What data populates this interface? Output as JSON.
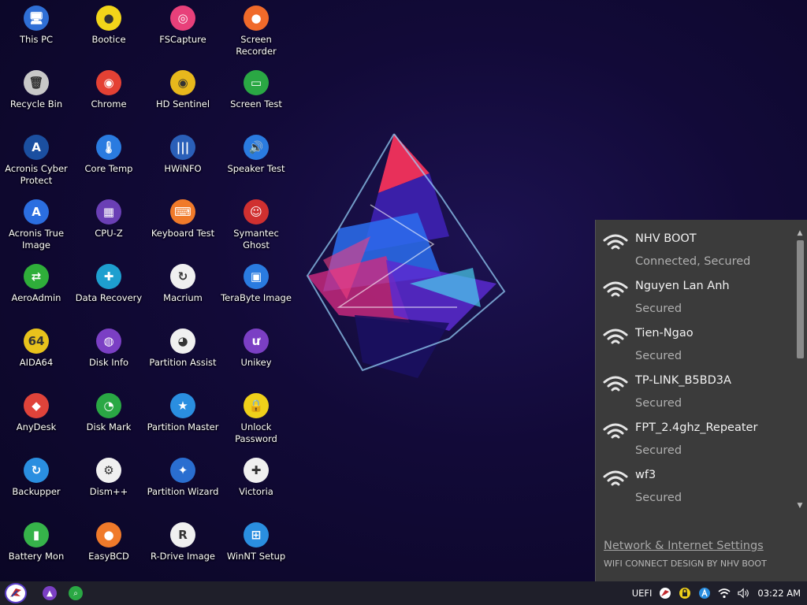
{
  "desktop": {
    "icons": [
      {
        "label": "This PC",
        "icon": "this-pc-icon",
        "color": "#2f6fd6",
        "glyph": "🖥"
      },
      {
        "label": "Recycle Bin",
        "icon": "recycle-bin-icon",
        "color": "#c8c8c8",
        "glyph": "🗑"
      },
      {
        "label": "Acronis Cyber Protect",
        "icon": "acronis-cyber-protect-icon",
        "color": "#1b4fa0",
        "glyph": "A"
      },
      {
        "label": "Acronis True Image",
        "icon": "acronis-true-image-icon",
        "color": "#2b6ee0",
        "glyph": "A"
      },
      {
        "label": "AeroAdmin",
        "icon": "aeroadmin-icon",
        "color": "#2fae3a",
        "glyph": "⇄"
      },
      {
        "label": "AIDA64",
        "icon": "aida64-icon",
        "color": "#e8c21c",
        "glyph": "64"
      },
      {
        "label": "AnyDesk",
        "icon": "anydesk-icon",
        "color": "#e0433a",
        "glyph": "◆"
      },
      {
        "label": "Backupper",
        "icon": "backupper-icon",
        "color": "#2a8ee0",
        "glyph": "↻"
      },
      {
        "label": "Battery Mon",
        "icon": "battery-mon-icon",
        "color": "#36b34a",
        "glyph": "▮"
      },
      {
        "label": "Bootice",
        "icon": "bootice-icon",
        "color": "#f2d51a",
        "glyph": "●"
      },
      {
        "label": "Chrome",
        "icon": "chrome-icon",
        "color": "#e44134",
        "glyph": "◉"
      },
      {
        "label": "Core Temp",
        "icon": "core-temp-icon",
        "color": "#2a7be0",
        "glyph": "🌡"
      },
      {
        "label": "CPU-Z",
        "icon": "cpu-z-icon",
        "color": "#6a3fb5",
        "glyph": "▦"
      },
      {
        "label": "Data Recovery",
        "icon": "data-recovery-icon",
        "color": "#1e9fcf",
        "glyph": "✚"
      },
      {
        "label": "Disk Info",
        "icon": "disk-info-icon",
        "color": "#7b3fc4",
        "glyph": "◍"
      },
      {
        "label": "Disk Mark",
        "icon": "disk-mark-icon",
        "color": "#2aa844",
        "glyph": "◔"
      },
      {
        "label": "Dism++",
        "icon": "dism-icon",
        "color": "#f0f0f0",
        "glyph": "⚙"
      },
      {
        "label": "EasyBCD",
        "icon": "easybcd-icon",
        "color": "#f07a2a",
        "glyph": "●"
      },
      {
        "label": "FSCapture",
        "icon": "fscapture-icon",
        "color": "#e8407a",
        "glyph": "◎"
      },
      {
        "label": "HD Sentinel",
        "icon": "hd-sentinel-icon",
        "color": "#e8b81c",
        "glyph": "◉"
      },
      {
        "label": "HWiNFO",
        "icon": "hwinfo-icon",
        "color": "#2a5fb8",
        "glyph": "|||"
      },
      {
        "label": "Keyboard Test",
        "icon": "keyboard-test-icon",
        "color": "#f07a2a",
        "glyph": "⌨"
      },
      {
        "label": "Macrium",
        "icon": "macrium-icon",
        "color": "#f0f0f0",
        "glyph": "↻"
      },
      {
        "label": "Partition Assist",
        "icon": "partition-assist-icon",
        "color": "#f0f0f0",
        "glyph": "◕"
      },
      {
        "label": "Partition Master",
        "icon": "partition-master-icon",
        "color": "#2a8ee0",
        "glyph": "★"
      },
      {
        "label": "Partition Wizard",
        "icon": "partition-wizard-icon",
        "color": "#2a6ed0",
        "glyph": "✦"
      },
      {
        "label": "R-Drive Image",
        "icon": "r-drive-image-icon",
        "color": "#f0f0f0",
        "glyph": "R"
      },
      {
        "label": "Screen Recorder",
        "icon": "screen-recorder-icon",
        "color": "#f06a2a",
        "glyph": "●"
      },
      {
        "label": "Screen Test",
        "icon": "screen-test-icon",
        "color": "#2aa844",
        "glyph": "▭"
      },
      {
        "label": "Speaker Test",
        "icon": "speaker-test-icon",
        "color": "#2a7be0",
        "glyph": "🔊"
      },
      {
        "label": "Symantec Ghost",
        "icon": "symantec-ghost-icon",
        "color": "#d03030",
        "glyph": "☺"
      },
      {
        "label": "TeraByte Image",
        "icon": "terabyte-image-icon",
        "color": "#2a7be0",
        "glyph": "▣"
      },
      {
        "label": "Unikey",
        "icon": "unikey-icon",
        "color": "#7b3fc4",
        "glyph": "ư"
      },
      {
        "label": "Unlock Password",
        "icon": "unlock-password-icon",
        "color": "#f0d01a",
        "glyph": "🔒"
      },
      {
        "label": "Victoria",
        "icon": "victoria-icon",
        "color": "#f0f0f0",
        "glyph": "✚"
      },
      {
        "label": "WinNT Setup",
        "icon": "winnt-setup-icon",
        "color": "#2a8ee0",
        "glyph": "⊞"
      }
    ]
  },
  "wifi": {
    "networks": [
      {
        "ssid": "NHV BOOT",
        "status": "Connected, Secured"
      },
      {
        "ssid": "Nguyen Lan Anh",
        "status": "Secured"
      },
      {
        "ssid": "Tien-Ngao",
        "status": "Secured"
      },
      {
        "ssid": "TP-LINK_B5BD3A",
        "status": "Secured"
      },
      {
        "ssid": "FPT_2.4ghz_Repeater",
        "status": "Secured"
      },
      {
        "ssid": "wf3",
        "status": "Secured"
      }
    ],
    "settings_link": "Network & Internet Settings",
    "credit": "WIFI CONNECT DESIGN BY NHV BOOT"
  },
  "taskbar": {
    "start_icon": "start-logo-icon",
    "apps": [
      {
        "icon": "app-launcher-icon",
        "color": "#7b3fc4"
      },
      {
        "icon": "search-app-icon",
        "color": "#2aa844"
      }
    ],
    "tray": {
      "boot_mode": "UEFI",
      "clock": "03:22 AM"
    }
  }
}
